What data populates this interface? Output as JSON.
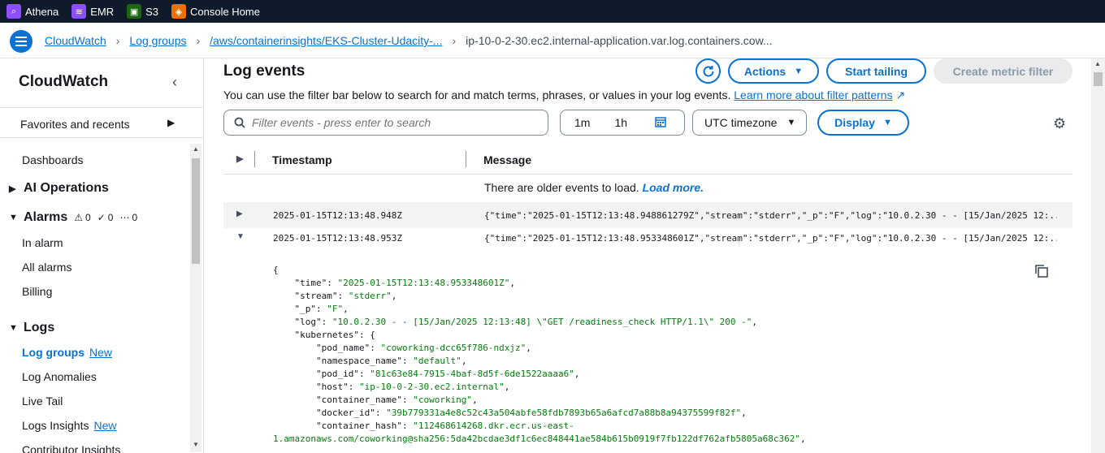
{
  "favorites": [
    {
      "label": "Athena",
      "icon": "athena-icon",
      "color": "#8c4fff"
    },
    {
      "label": "EMR",
      "icon": "emr-icon",
      "color": "#8c4fff"
    },
    {
      "label": "S3",
      "icon": "s3-icon",
      "color": "#1b660f"
    },
    {
      "label": "Console Home",
      "icon": "console-home-icon",
      "color": "#ed7100"
    }
  ],
  "breadcrumb": {
    "items": [
      "CloudWatch",
      "Log groups",
      "/aws/containerinsights/EKS-Cluster-Udacity-..."
    ],
    "current": "ip-10-0-2-30.ec2.internal-application.var.log.containers.cow..."
  },
  "sidebar": {
    "title": "CloudWatch",
    "favorites_label": "Favorites and recents",
    "dashboards": "Dashboards",
    "ai_operations": "AI Operations",
    "alarms": "Alarms",
    "alarm_counts": [
      "0",
      "0",
      "0"
    ],
    "in_alarm": "In alarm",
    "all_alarms": "All alarms",
    "billing": "Billing",
    "logs": "Logs",
    "log_groups": "Log groups",
    "new_label": "New",
    "log_anomalies": "Log Anomalies",
    "live_tail": "Live Tail",
    "logs_insights": "Logs Insights",
    "contributor_insights": "Contributor Insights"
  },
  "main": {
    "title": "Log events",
    "actions_label": "Actions",
    "start_tailing_label": "Start tailing",
    "create_metric_filter_label": "Create metric filter",
    "description": "You can use the filter bar below to search for and match terms, phrases, or values in your log events.",
    "learn_more": "Learn more about filter patterns",
    "search_placeholder": "Filter events - press enter to search",
    "range_1m": "1m",
    "range_1h": "1h",
    "timezone": "UTC timezone",
    "display_label": "Display",
    "columns": {
      "timestamp": "Timestamp",
      "message": "Message"
    },
    "older_events": "There are older events to load.",
    "load_more": "Load more.",
    "rows": [
      {
        "timestamp": "2025-01-15T12:13:48.948Z",
        "message": "{\"time\":\"2025-01-15T12:13:48.948861279Z\",\"stream\":\"stderr\",\"_p\":\"F\",\"log\":\"10.0.2.30 - - [15/Jan/2025 12:..."
      },
      {
        "timestamp": "2025-01-15T12:13:48.953Z",
        "message": "{\"time\":\"2025-01-15T12:13:48.953348601Z\",\"stream\":\"stderr\",\"_p\":\"F\",\"log\":\"10.0.2.30 - - [15/Jan/2025 12:..."
      }
    ],
    "expanded": {
      "open": "{",
      "time_key": "\"time\": ",
      "time_val": "\"2025-01-15T12:13:48.953348601Z\"",
      "stream_key": "\"stream\": ",
      "stream_val": "\"stderr\"",
      "p_key": "\"_p\": ",
      "p_val": "\"F\"",
      "log_key": "\"log\": ",
      "log_val": "\"10.0.2.30 - - [15/Jan/2025 12:13:48] \\\"GET /readiness_check HTTP/1.1\\\" 200 -\"",
      "k8s_key": "\"kubernetes\": {",
      "pod_name_key": "\"pod_name\": ",
      "pod_name_val": "\"coworking-dcc65f786-ndxjz\"",
      "namespace_key": "\"namespace_name\": ",
      "namespace_val": "\"default\"",
      "pod_id_key": "\"pod_id\": ",
      "pod_id_val": "\"81c63e84-7915-4baf-8d5f-6de1522aaaa6\"",
      "host_key": "\"host\": ",
      "host_val": "\"ip-10-0-2-30.ec2.internal\"",
      "container_name_key": "\"container_name\": ",
      "container_name_val": "\"coworking\"",
      "docker_id_key": "\"docker_id\": ",
      "docker_id_val": "\"39b779331a4e8c52c43a504abfe58fdb7893b65a6afcd7a88b8a94375599f82f\"",
      "container_hash_key": "\"container_hash\": ",
      "container_hash_val1": "\"112468614268.dkr.ecr.us-east-",
      "container_hash_val2": "1.amazonaws.com/coworking@sha256:5da42bcdae3df1c6ec848441ae584b615b0919f7fb122df762afb5805a68c362\""
    }
  }
}
